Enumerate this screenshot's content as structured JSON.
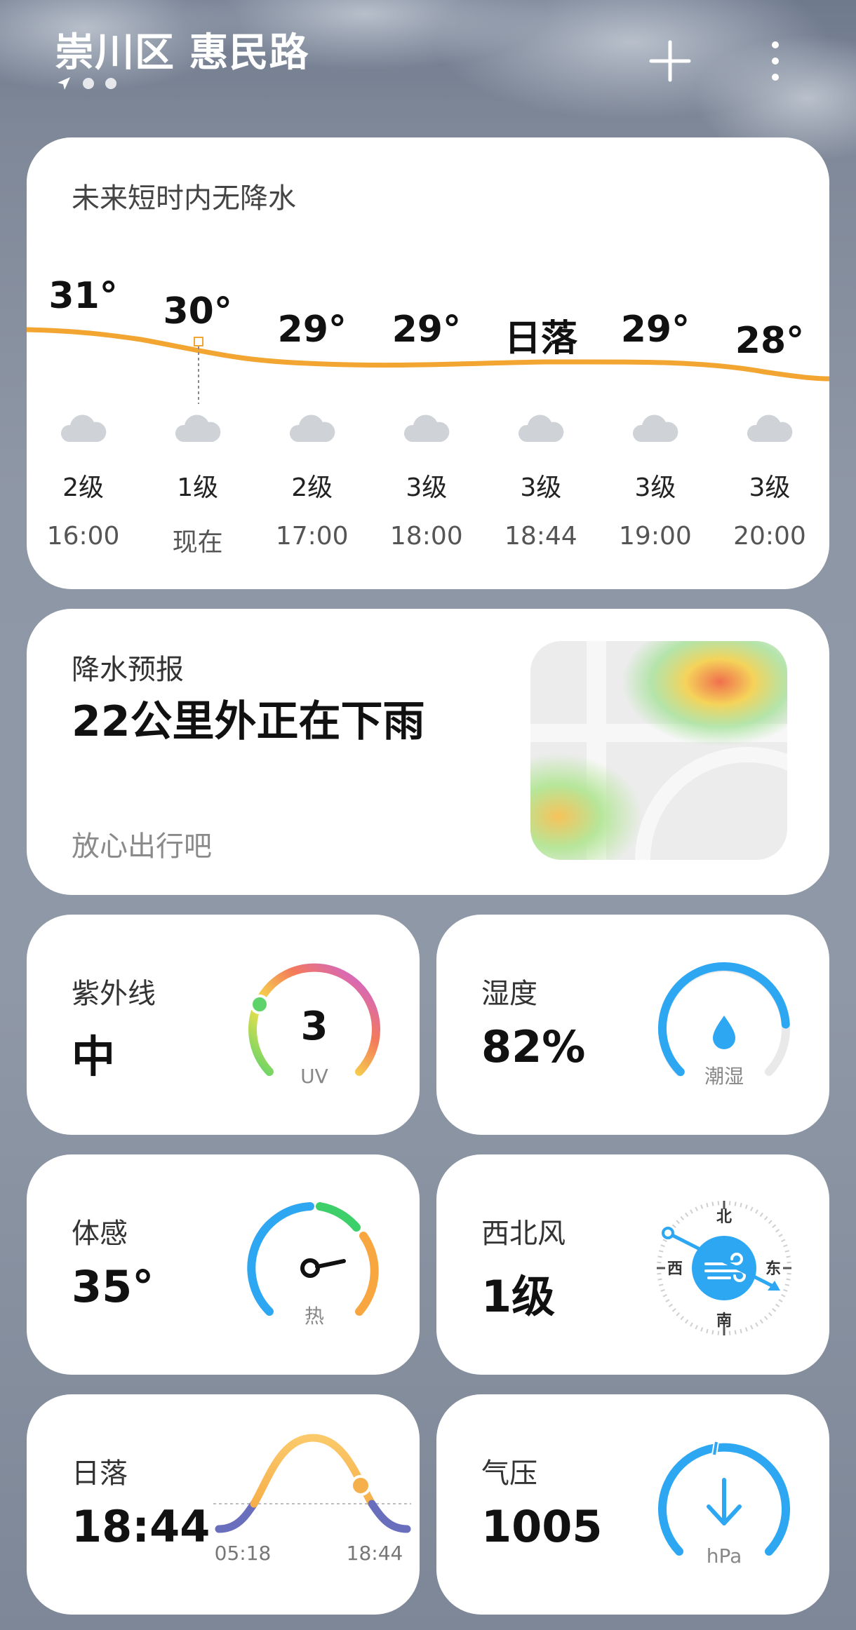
{
  "header": {
    "location": "崇川区 惠民路"
  },
  "hourly": {
    "summary": "未来短时内无降水",
    "items": [
      {
        "temp": "31°",
        "wind": "2级",
        "time": "16:00"
      },
      {
        "temp": "30°",
        "wind": "1级",
        "time": "现在"
      },
      {
        "temp": "29°",
        "wind": "2级",
        "time": "17:00"
      },
      {
        "temp": "29°",
        "wind": "3级",
        "time": "18:00"
      },
      {
        "temp": "日落",
        "wind": "3级",
        "time": "18:44"
      },
      {
        "temp": "29°",
        "wind": "3级",
        "time": "19:00"
      },
      {
        "temp": "28°",
        "wind": "3级",
        "time": "20:00"
      }
    ],
    "curve_color": "#f2a531"
  },
  "precip": {
    "title": "降水预报",
    "headline": "22公里外正在下雨",
    "note": "放心出行吧"
  },
  "uv": {
    "title": "紫外线",
    "level": "中",
    "value": "3",
    "unit": "UV"
  },
  "humidity": {
    "title": "湿度",
    "value": "82%",
    "label": "潮湿",
    "fraction": 0.82,
    "color": "#2ea7f2"
  },
  "feels": {
    "title": "体感",
    "value": "35°",
    "label": "热"
  },
  "wind": {
    "title": "西北风",
    "value": "1级",
    "n": "北",
    "s": "南",
    "w": "西",
    "e": "东",
    "color": "#2ea7f2"
  },
  "sunset": {
    "title": "日落",
    "value": "18:44",
    "sunrise_time": "05:18",
    "sunset_time": "18:44"
  },
  "pressure": {
    "title": "气压",
    "value": "1005",
    "unit": "hPa",
    "color": "#2ea7f2"
  }
}
